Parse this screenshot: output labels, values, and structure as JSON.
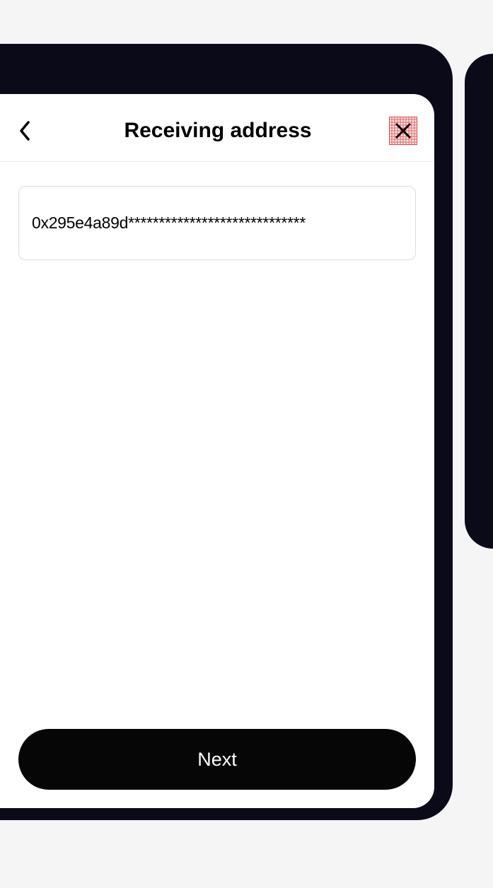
{
  "header": {
    "title": "Receiving address"
  },
  "form": {
    "address_value": "0x295e4a89d*****************************"
  },
  "footer": {
    "next_label": "Next"
  },
  "icons": {
    "back": "back-chevron-icon",
    "scan": "qr-scan-icon"
  }
}
